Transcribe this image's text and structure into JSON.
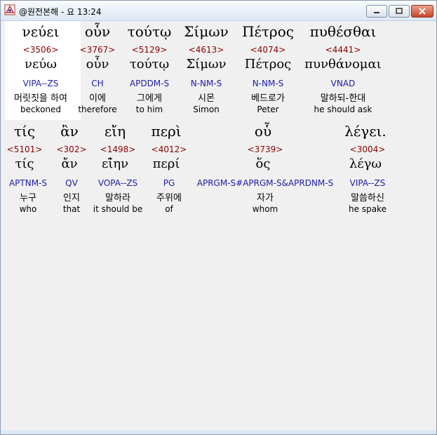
{
  "window": {
    "title": "@원전본해 - 요 13:24",
    "controls": {
      "minimize": "—",
      "maximize": "□",
      "close": "✕"
    }
  },
  "row1": [
    {
      "word": "νεύει",
      "strong": "<3506>",
      "lemma": "νεύω",
      "morph": "VIPA--ZS",
      "korean": "머릿짓을 하여",
      "english": "beckoned"
    },
    {
      "word": "οὖν",
      "strong": "<3767>",
      "lemma": "οὖν",
      "morph": "CH",
      "korean": "이에",
      "english": "therefore"
    },
    {
      "word": "τούτῳ",
      "strong": "<5129>",
      "lemma": "τούτῳ",
      "morph": "APDDM-S",
      "korean": "그에게",
      "english": "to him"
    },
    {
      "word": "Σίμων",
      "strong": "<4613>",
      "lemma": "Σίμων",
      "morph": "N-NM-S",
      "korean": "시몬",
      "english": "Simon"
    },
    {
      "word": "Πέτρος",
      "strong": "<4074>",
      "lemma": "Πέτρος",
      "morph": "N-NM-S",
      "korean": "베드로가",
      "english": "Peter"
    },
    {
      "word": "πυθέσθαι",
      "strong": "<4441>",
      "lemma": "πυνθάνομαι",
      "morph": "VNAD",
      "korean": "말하되-한대",
      "english": "he should ask"
    }
  ],
  "row2": [
    {
      "word": "τίς",
      "strong": "<5101>",
      "lemma": "τίς",
      "morph": "APTNM-S",
      "korean": "누구",
      "english": "who"
    },
    {
      "word": "ἂν",
      "strong": "<302>",
      "lemma": "ἄν",
      "morph": "QV",
      "korean": "인지",
      "english": "that"
    },
    {
      "word": "εἴη",
      "strong": "<1498>",
      "lemma": "εἰ̃ην",
      "morph": "VOPA--ZS",
      "korean": "말하라",
      "english": "it should be"
    },
    {
      "word": "περὶ",
      "strong": "<4012>",
      "lemma": "περί",
      "morph": "PG",
      "korean": "주위에",
      "english": "of"
    },
    {
      "word": "οὗ",
      "strong": "<3739>",
      "lemma": "ὅς",
      "morph": "APRGM-S#APRGM-S&APRDNM-S",
      "korean": "자가",
      "english": "whom"
    },
    {
      "word": "λέγει.",
      "strong": "<3004>",
      "lemma": "λέγω",
      "morph": "VIPA--ZS",
      "korean": "말씀하신",
      "english": "he spake"
    }
  ],
  "colors": {
    "strong": "#8b0000",
    "morph": "#1c1caa",
    "highlight": "#ffffff"
  }
}
